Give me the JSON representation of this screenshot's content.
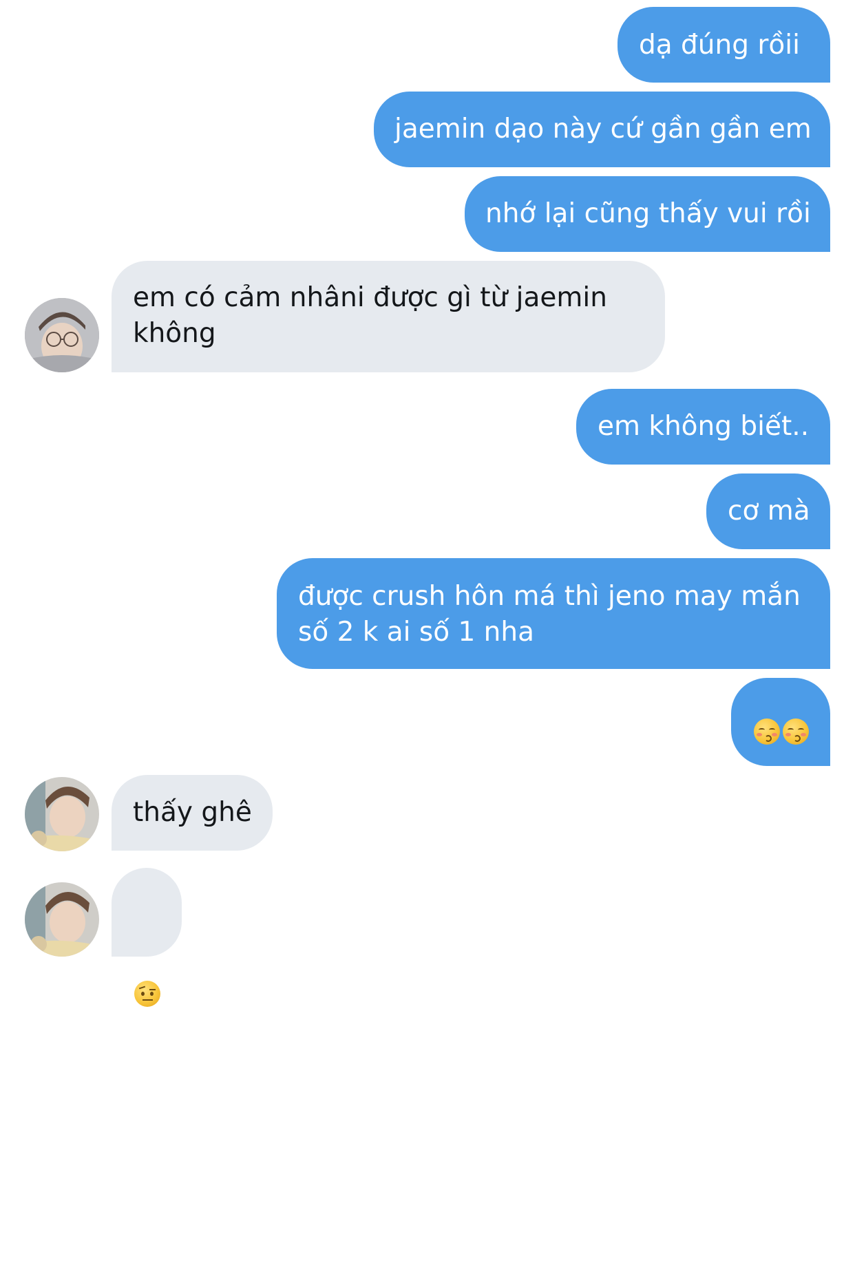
{
  "conversation": {
    "messages": [
      {
        "side": "out",
        "text": "dạ đúng rồii"
      },
      {
        "side": "out",
        "text": "jaemin dạo này cứ gần gần em"
      },
      {
        "side": "out",
        "text": "nhớ lại cũng thấy vui rồi"
      },
      {
        "side": "in",
        "text": "em có cảm nhâni được gì từ jaemin\nkhông",
        "avatar": "avatar-glasses"
      },
      {
        "side": "out",
        "text": "em không biết.."
      },
      {
        "side": "out",
        "text": "cơ mà"
      },
      {
        "side": "out",
        "text": "được crush hôn má thì jeno may mắn\nsố 2 k ai số 1 nha"
      },
      {
        "side": "out",
        "emoji": [
          "kissing-face-smiling-eyes",
          "kissing-face-smiling-eyes"
        ]
      },
      {
        "side": "in",
        "text": "thấy ghê",
        "avatar": "avatar-boy"
      },
      {
        "side": "in",
        "emoji": [
          "face-with-raised-eyebrow"
        ],
        "avatar": "avatar-boy"
      }
    ]
  },
  "colors": {
    "outgoing_bubble": "#4c9ce8",
    "incoming_bubble": "#e6eaef",
    "outgoing_text": "#ffffff",
    "incoming_text": "#14171a"
  }
}
